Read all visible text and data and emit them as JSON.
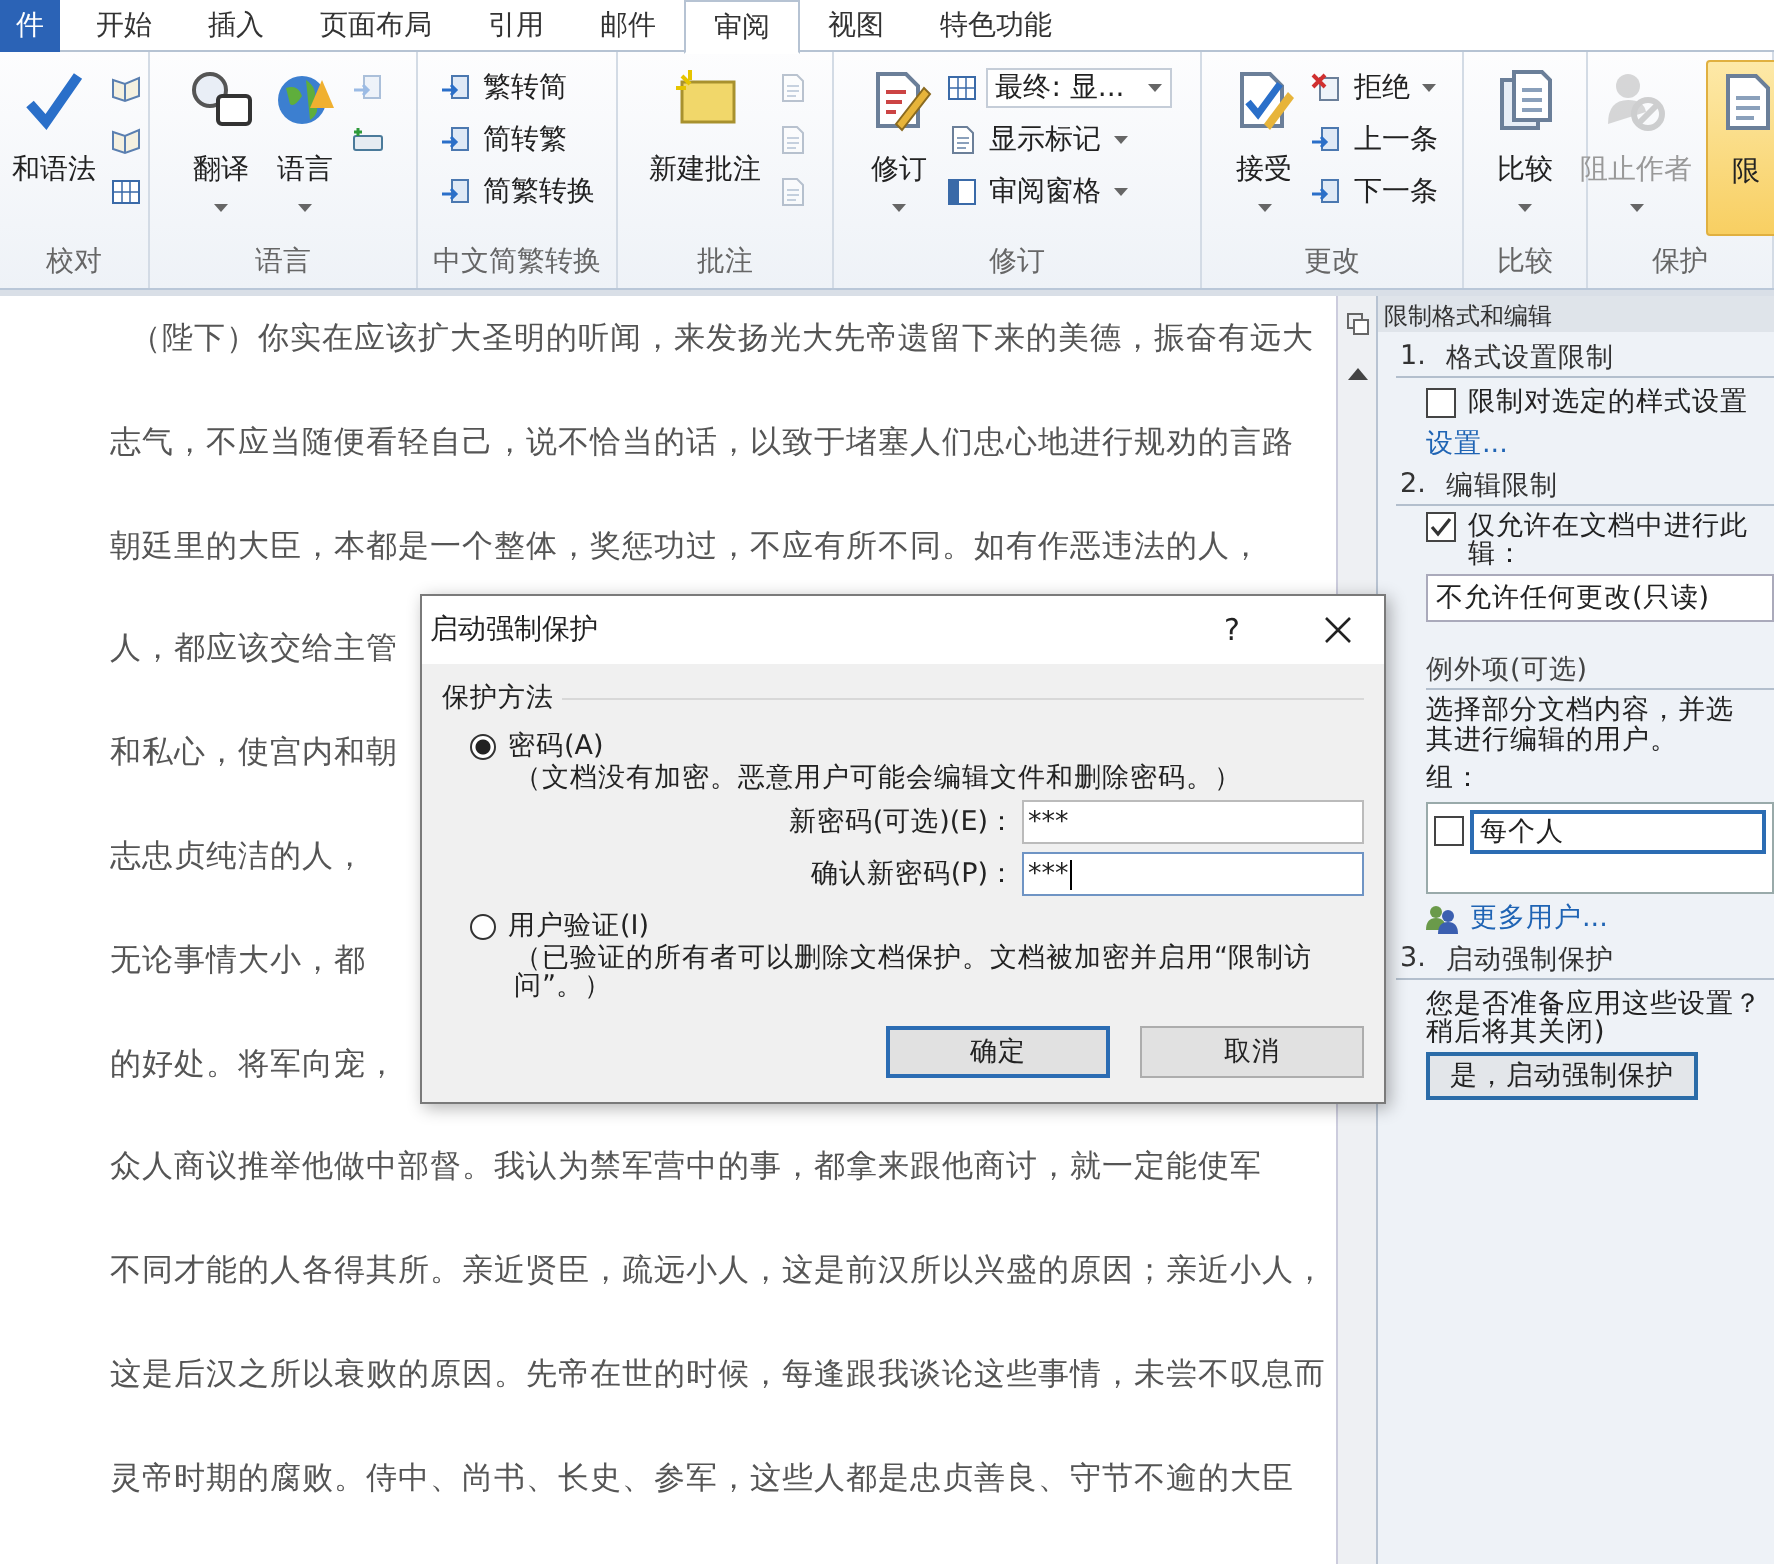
{
  "ribbon": {
    "tabs": [
      {
        "label": "件",
        "kind": "file",
        "selected": false
      },
      {
        "label": "开始",
        "kind": "tab",
        "selected": false
      },
      {
        "label": "插入",
        "kind": "tab",
        "selected": false
      },
      {
        "label": "页面布局",
        "kind": "tab",
        "selected": false
      },
      {
        "label": "引用",
        "kind": "tab",
        "selected": false
      },
      {
        "label": "邮件",
        "kind": "tab",
        "selected": false
      },
      {
        "label": "审阅",
        "kind": "tab",
        "selected": true
      },
      {
        "label": "视图",
        "kind": "tab",
        "selected": false
      },
      {
        "label": "特色功能",
        "kind": "tab",
        "selected": false
      }
    ],
    "groups": [
      {
        "label": "校对",
        "items": [
          {
            "kind": "large",
            "label": "和语法",
            "has_menu": false,
            "disabled": false,
            "pressed": false
          },
          {
            "kind": "icon",
            "disabled": false
          },
          {
            "kind": "icon",
            "disabled": false
          },
          {
            "kind": "icon",
            "disabled": false
          }
        ]
      },
      {
        "label": "语言",
        "items": [
          {
            "kind": "large",
            "label": "翻译",
            "has_menu": true,
            "disabled": false,
            "pressed": false
          },
          {
            "kind": "large",
            "label": "语言",
            "has_menu": true,
            "disabled": false,
            "pressed": false
          },
          {
            "kind": "icon",
            "disabled": true
          },
          {
            "kind": "icon",
            "disabled": false
          }
        ]
      },
      {
        "label": "中文简繁转换",
        "items": [
          {
            "kind": "small",
            "label": "繁转简",
            "has_menu": false,
            "disabled": false
          },
          {
            "kind": "small",
            "label": "简转繁",
            "has_menu": false,
            "disabled": false
          },
          {
            "kind": "small",
            "label": "简繁转换",
            "has_menu": false,
            "disabled": false
          }
        ]
      },
      {
        "label": "批注",
        "items": [
          {
            "kind": "large",
            "label": "新建批注",
            "has_menu": false,
            "disabled": false,
            "pressed": false
          },
          {
            "kind": "icon",
            "disabled": true
          },
          {
            "kind": "icon",
            "disabled": true
          },
          {
            "kind": "icon",
            "disabled": true
          }
        ]
      },
      {
        "label": "修订",
        "items": [
          {
            "kind": "large",
            "label": "修订",
            "has_menu": true,
            "disabled": false,
            "pressed": false
          },
          {
            "kind": "combo",
            "value": "最终: 显..."
          },
          {
            "kind": "small",
            "label": "显示标记",
            "has_menu": true,
            "disabled": false
          },
          {
            "kind": "small",
            "label": "审阅窗格",
            "has_menu": true,
            "disabled": false
          }
        ]
      },
      {
        "label": "更改",
        "items": [
          {
            "kind": "large",
            "label": "接受",
            "has_menu": true,
            "disabled": false,
            "pressed": false
          },
          {
            "kind": "small",
            "label": "拒绝",
            "has_menu": true,
            "disabled": false
          },
          {
            "kind": "small",
            "label": "上一条",
            "has_menu": false,
            "disabled": false
          },
          {
            "kind": "small",
            "label": "下一条",
            "has_menu": false,
            "disabled": false
          }
        ]
      },
      {
        "label": "比较",
        "items": [
          {
            "kind": "large",
            "label": "比较",
            "has_menu": true,
            "disabled": false,
            "pressed": false
          }
        ]
      },
      {
        "label": "保护",
        "items": [
          {
            "kind": "large",
            "label": "阻止作者",
            "has_menu": true,
            "disabled": true,
            "pressed": false
          },
          {
            "kind": "large",
            "label": "限",
            "has_menu": false,
            "disabled": false,
            "pressed": true
          }
        ]
      }
    ]
  },
  "document": {
    "lines": [
      "（陛下）你实在应该扩大圣明的听闻，来发扬光大先帝遗留下来的美德，振奋有远大",
      "志气，不应当随便看轻自己，说不恰当的话，以致于堵塞人们忠心地进行规劝的言路",
      "朝廷里的大臣，本都是一个整体，奖惩功过，不应有所不同。如有作恶违法的人，",
      "人，都应该交给主管",
      "和私心，使宫内和朝",
      "志忠贞纯洁的人，",
      "无论事情大小，都",
      "的好处。将军向宠，",
      "众人商议推举他做中部督。我认为禁军营中的事，都拿来跟他商讨，就一定能使军",
      "不同才能的人各得其所。亲近贤臣，疏远小人，这是前汉所以兴盛的原因；亲近小人，",
      "这是后汉之所以衰败的原因。先帝在世的时候，每逢跟我谈论这些事情，未尝不叹息而",
      "灵帝时期的腐败。侍中、尚书、长史、参军，这些人都是忠贞善良、守节不逾的大臣"
    ]
  },
  "task_pane": {
    "title": "限制格式和编辑",
    "formatting": {
      "number": "1.",
      "heading": "格式设置限制",
      "checkbox": {
        "label": "限制对选定的样式设置",
        "checked": false
      },
      "link": "设置..."
    },
    "editing": {
      "number": "2.",
      "heading": "编辑限制",
      "checkbox": {
        "label_lines": [
          "仅允许在文档中进行此",
          "辑："
        ],
        "checked": true
      },
      "dropdown": {
        "value": "不允许任何更改(只读)"
      },
      "exceptions": {
        "heading": "例外项(可选)",
        "description_lines": [
          "选择部分文档内容，并选",
          "其进行编辑的用户。"
        ],
        "groups_label": "组：",
        "groups": [
          {
            "label": "每个人",
            "checked": false,
            "selected": true
          }
        ],
        "link": "更多用户..."
      }
    },
    "enforcement": {
      "number": "3.",
      "heading": "启动强制保护",
      "question_lines": [
        "您是否准备应用这些设置？",
        "稍后将其关闭)"
      ],
      "button": "是，启动强制保护"
    }
  },
  "dialog": {
    "title": "启动强制保护",
    "help": "?",
    "group_label": "保护方法",
    "methods": [
      {
        "label": "密码(A)",
        "selected": true,
        "description": "（文档没有加密。恶意用户可能会编辑文件和删除密码。）",
        "fields": [
          {
            "label": "新密码(可选)(E)：",
            "value": "***",
            "focused": false
          },
          {
            "label": "确认新密码(P)：",
            "value": "***",
            "focused": true
          }
        ]
      },
      {
        "label": "用户验证(I)",
        "selected": false,
        "description": "（已验证的所有者可以删除文档保护。文档被加密并启用“限制访问”。）"
      }
    ],
    "buttons": [
      {
        "label": "确定",
        "default": true
      },
      {
        "label": "取消",
        "default": false
      }
    ]
  }
}
